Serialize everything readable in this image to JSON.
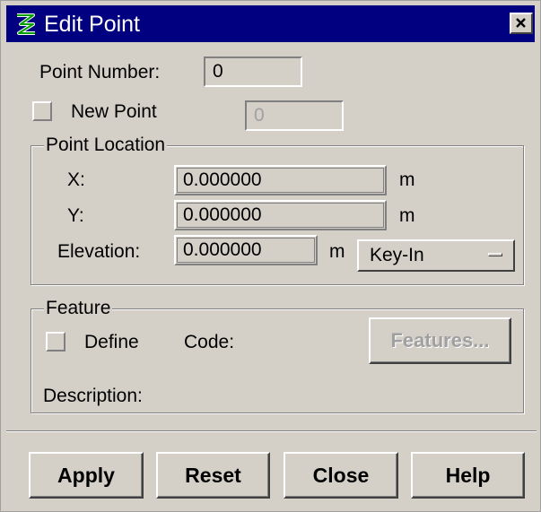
{
  "window": {
    "title": "Edit Point",
    "icon": "app-logo-icon",
    "close_icon": "close-x-icon",
    "titlebar_color": "#000080",
    "close_glyph": "✕"
  },
  "point": {
    "number_label": "Point Number:",
    "number_value": "0",
    "new_point_label": "New Point",
    "new_point_value": "0"
  },
  "location": {
    "group_label": "Point Location",
    "x_label": "X:",
    "x_value": "0.000000",
    "x_unit": "m",
    "y_label": "Y:",
    "y_value": "0.000000",
    "y_unit": "m",
    "elev_label": "Elevation:",
    "elev_value": "0.000000",
    "elev_unit": "m",
    "mode_value": "Key-In"
  },
  "feature": {
    "group_label": "Feature",
    "define_label": "Define",
    "code_label": "Code:",
    "features_button": "Features...",
    "description_label": "Description:"
  },
  "buttons": {
    "apply": "Apply",
    "reset": "Reset",
    "close": "Close",
    "help": "Help"
  }
}
